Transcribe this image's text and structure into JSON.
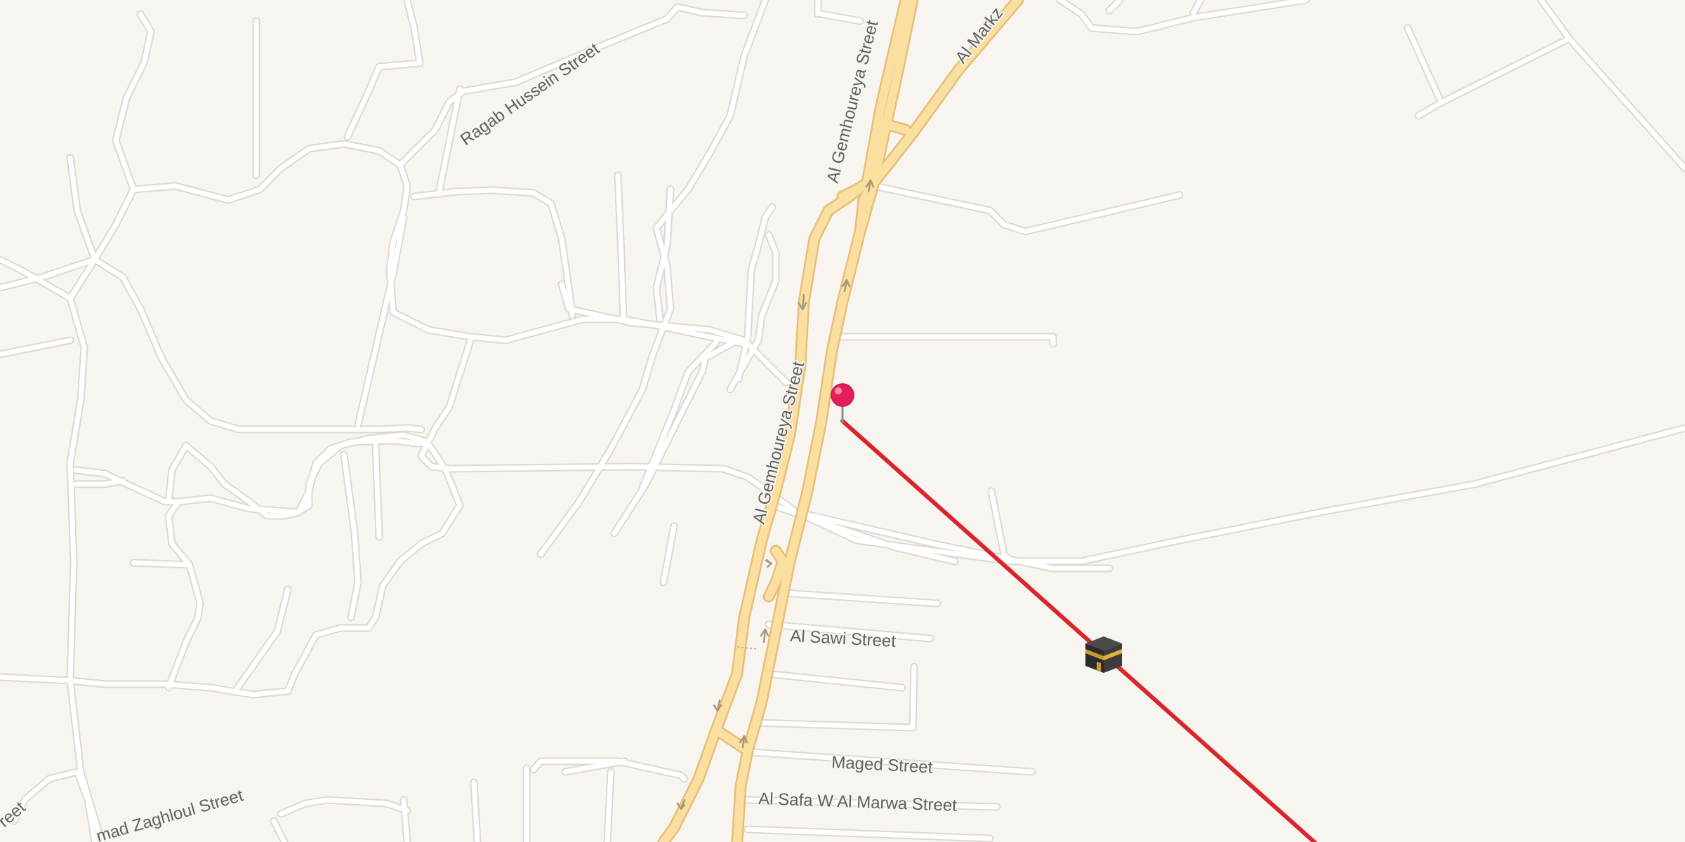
{
  "map": {
    "background": "#f8f5f0",
    "colors": {
      "minor_road": "#ffffff",
      "minor_road_casing": "#dedad3",
      "major_road": "#fbdfa0",
      "major_road_casing": "#e8c27a",
      "qibla_line": "#d8262b",
      "pin": "#e61e5a",
      "oneway_arrow": "#a8987a"
    },
    "streets": [
      {
        "label": "Ragab Hussein Street"
      },
      {
        "label": "Al Gemhoureya Street"
      },
      {
        "label": "Al Gemhoureya Street"
      },
      {
        "label": "Al Markz"
      },
      {
        "label": "Al Sawi Street"
      },
      {
        "label": "Maged Street"
      },
      {
        "label": "Al Safa W Al Marwa Street"
      },
      {
        "label": "mad Zaghloul Street"
      },
      {
        "label": "reet"
      }
    ],
    "markers": {
      "location_pin": {
        "icon": "map-pin-icon"
      },
      "qibla_direction": {
        "icon": "kaaba-icon"
      }
    }
  }
}
